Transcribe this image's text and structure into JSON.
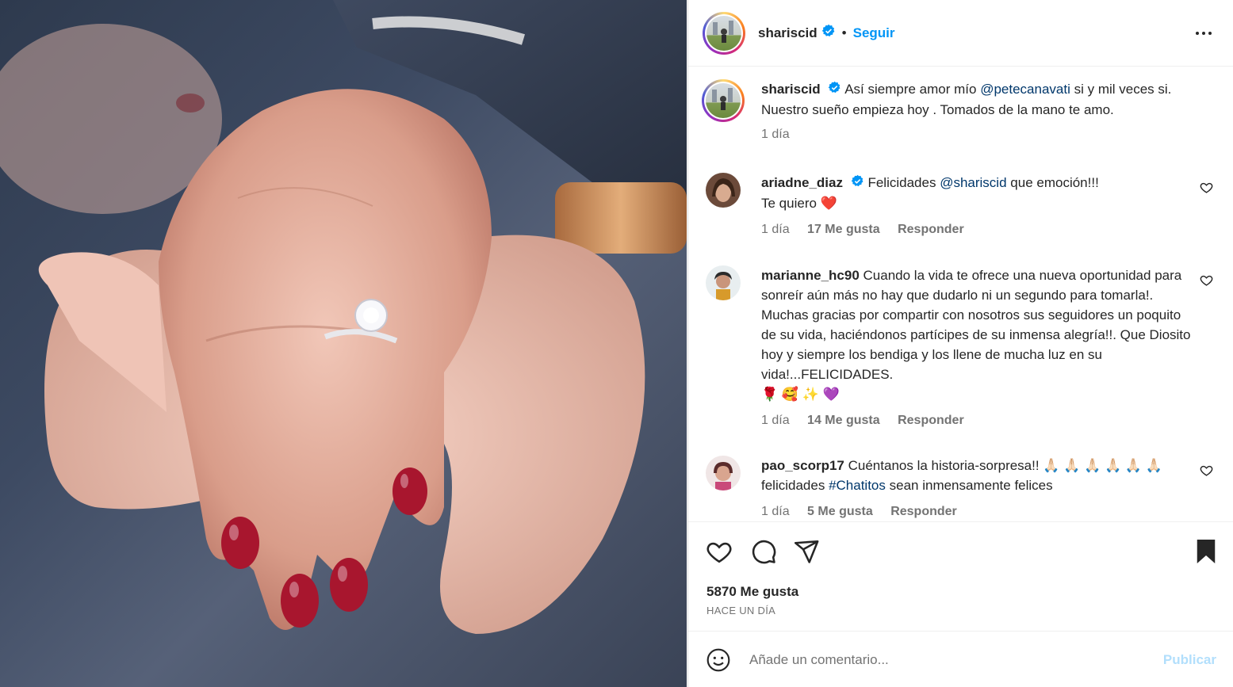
{
  "post": {
    "username": "shariscid",
    "follow_label": "Seguir",
    "separator": "•"
  },
  "caption": {
    "username": "shariscid",
    "text_before": "Así siempre amor mío",
    "mention": "@petecanavati",
    "text_after": "si y mil veces si. Nuestro sueño empieza hoy . Tomados de la mano te amo.",
    "time": "1 día"
  },
  "comments": [
    {
      "username": "ariadne_diaz",
      "text_before": "Felicidades",
      "mention": "@shariscid",
      "text_after": "que emoción!!!",
      "line2": "Te quiero",
      "emoji": "❤️",
      "time": "1 día",
      "likes": "17 Me gusta",
      "reply": "Responder"
    },
    {
      "username": "marianne_hc90",
      "text": "Cuando la vida te ofrece una nueva oportunidad para sonreír aún más no hay que dudarlo ni un segundo para tomarla!. Muchas gracias por compartir con nosotros sus seguidores un poquito de su vida, haciéndonos partícipes de su inmensa alegría!!. Que Diosito hoy y siempre los bendiga y los llene de mucha luz en su vida!...FELICIDADES.",
      "emojis": "🌹 🥰 ✨ 💜",
      "time": "1 día",
      "likes": "14 Me gusta",
      "reply": "Responder"
    },
    {
      "username": "pao_scorp17",
      "text_before": "Cuéntanos la historia-sorpresa!!",
      "emojis": "🙏🏻 🙏🏻 🙏🏻 🙏🏻 🙏🏻 🙏🏻",
      "text_mid": "felicidades",
      "hashtag": "#Chatitos",
      "text_after": "sean inmensamente felices",
      "time": "1 día",
      "likes": "5 Me gusta",
      "reply": "Responder"
    }
  ],
  "stats": {
    "likes": "5870 Me gusta",
    "date": "HACE UN DÍA"
  },
  "add_comment": {
    "placeholder": "Añade un comentario...",
    "publish": "Publicar"
  },
  "colors": {
    "accent": "#0095f6",
    "mention": "#00376b",
    "muted": "#737373",
    "verified": "#0095f6",
    "publish_disabled": "#b2dffc"
  }
}
